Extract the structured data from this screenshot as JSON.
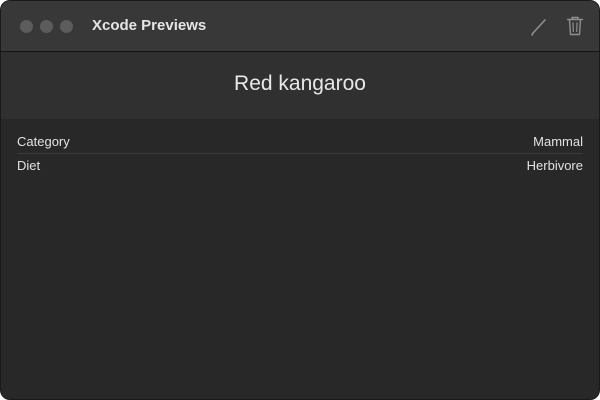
{
  "window": {
    "title": "Xcode Previews"
  },
  "toolbar": {
    "icons": [
      "pencil-icon",
      "trash-icon"
    ]
  },
  "detail": {
    "title": "Red kangaroo",
    "rows": [
      {
        "label": "Category",
        "value": "Mammal"
      },
      {
        "label": "Diet",
        "value": "Herbivore"
      }
    ]
  },
  "colors": {
    "background": "#282828",
    "titlebar": "#383838",
    "header": "#303030",
    "text": "#e6e6e6"
  }
}
